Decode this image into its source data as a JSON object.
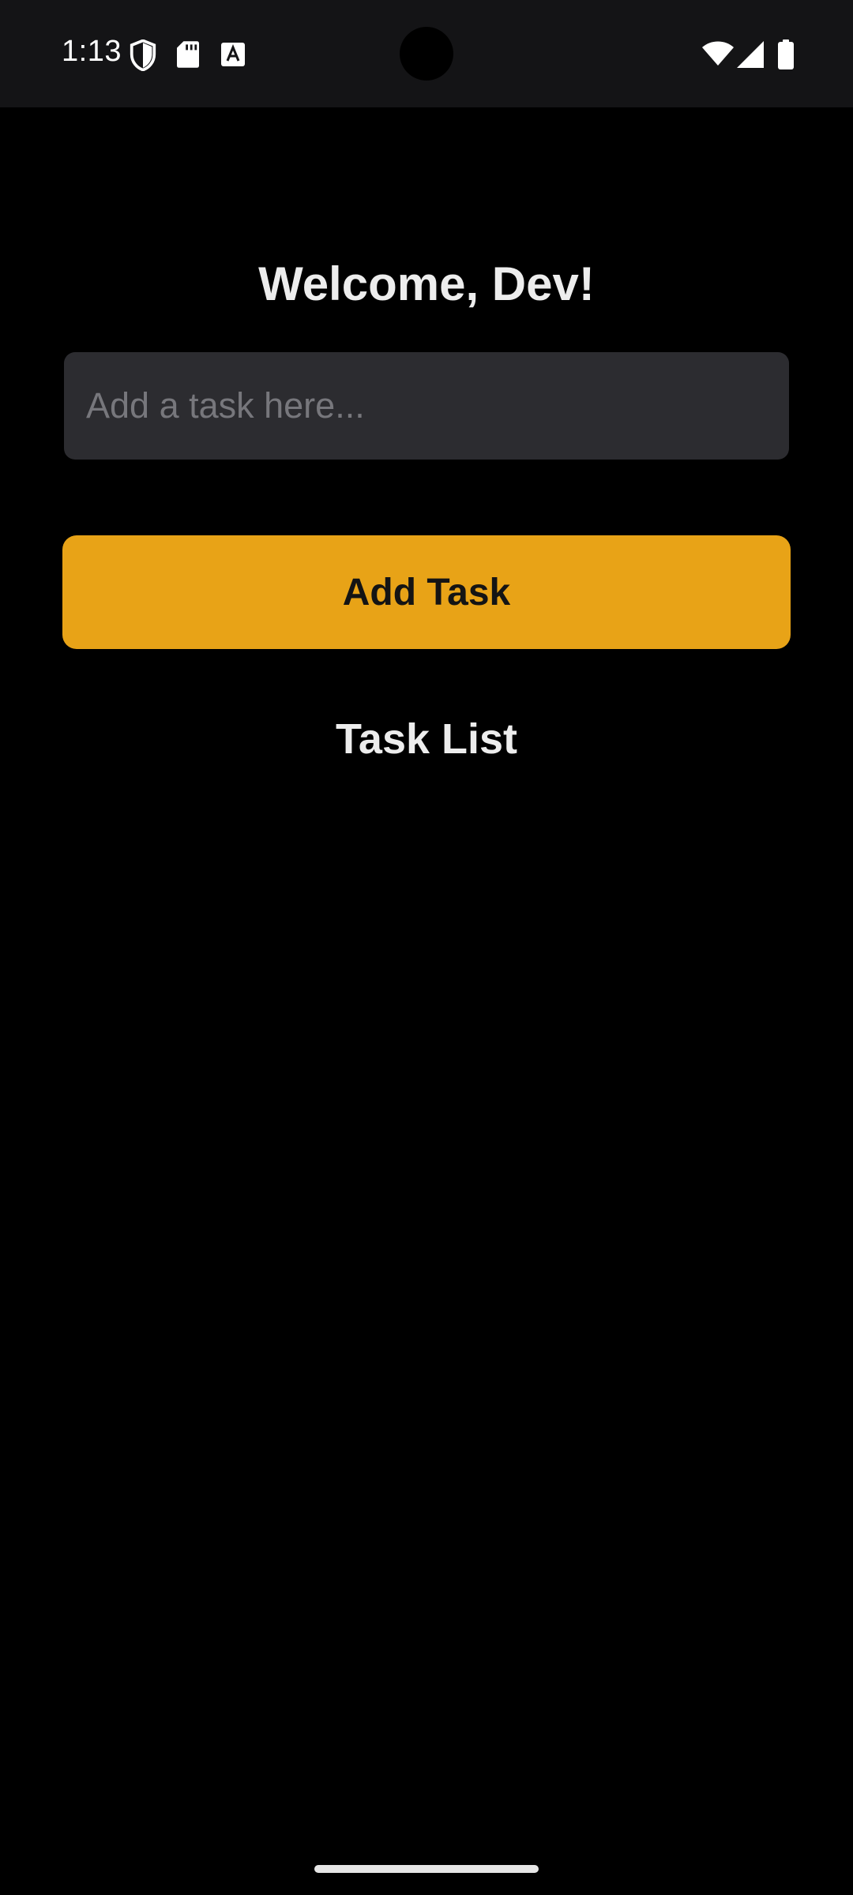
{
  "status_bar": {
    "time": "1:13",
    "icons": [
      "shield-icon",
      "sd-card-icon",
      "text-a-icon",
      "wifi-icon",
      "cell-signal-icon",
      "battery-icon"
    ]
  },
  "main": {
    "welcome_title": "Welcome, Dev!",
    "task_input": {
      "value": "",
      "placeholder": "Add a task here..."
    },
    "add_button_label": "Add Task",
    "task_list_heading": "Task List",
    "tasks": []
  },
  "colors": {
    "background": "#000000",
    "status_bar": "#141416",
    "input_background": "#2C2C30",
    "accent": "#E8A317",
    "text": "#EDEDED",
    "placeholder": "#77777C"
  }
}
